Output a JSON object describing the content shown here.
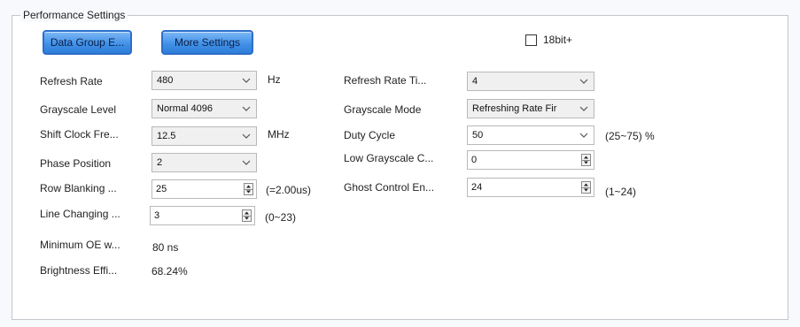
{
  "group": {
    "title": "Performance Settings"
  },
  "buttons": {
    "data_group": "Data Group E...",
    "more_settings": "More Settings"
  },
  "checkbox_18bit": {
    "label": "18bit+",
    "checked": false
  },
  "left": {
    "refresh_rate": {
      "label": "Refresh Rate",
      "value": "480",
      "unit": "Hz"
    },
    "grayscale_level": {
      "label": "Grayscale Level",
      "value": "Normal 4096"
    },
    "shift_clock": {
      "label": "Shift Clock Fre...",
      "value": "12.5",
      "unit": "MHz"
    },
    "phase_position": {
      "label": "Phase Position",
      "value": "2"
    },
    "row_blanking": {
      "label": "Row Blanking ...",
      "value": "25",
      "note": "(=2.00us)"
    },
    "line_changing": {
      "label": "Line Changing ...",
      "value": "3",
      "note": "(0~23)"
    },
    "min_oe": {
      "label": "Minimum OE w...",
      "value": "80 ns"
    },
    "brightness_eff": {
      "label": "Brightness Effi...",
      "value": "68.24%"
    }
  },
  "right": {
    "refresh_rate_times": {
      "label": "Refresh Rate Ti...",
      "value": "4"
    },
    "grayscale_mode": {
      "label": "Grayscale Mode",
      "value": "Refreshing Rate Fir"
    },
    "duty_cycle": {
      "label": "Duty Cycle",
      "value": "50",
      "note": "(25~75) %"
    },
    "low_grayscale": {
      "label": "Low Grayscale C...",
      "value": "0"
    },
    "ghost_control": {
      "label": "Ghost Control En...",
      "value": "24",
      "note": "(1~24)"
    }
  }
}
